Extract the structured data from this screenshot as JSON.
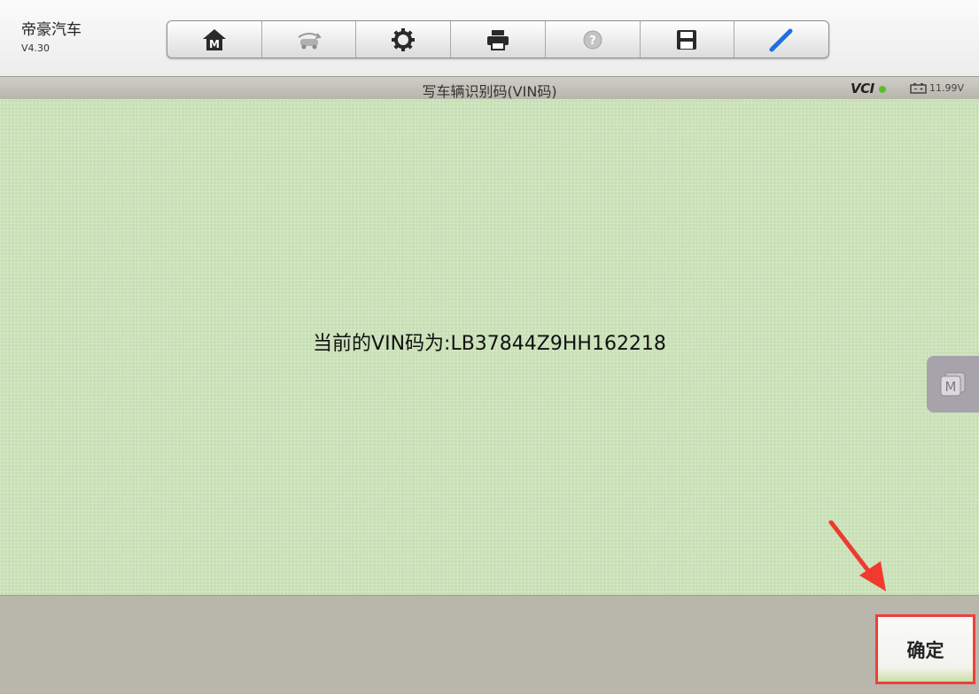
{
  "app": {
    "name": "帝豪汽车",
    "version": "V4.30"
  },
  "toolbar": {
    "tools": [
      "home-icon",
      "vehicle-swap-icon",
      "settings-icon",
      "print-icon",
      "help-icon",
      "save-icon",
      "edit-icon"
    ],
    "home_badge": "M"
  },
  "titlebar": {
    "title": "写车辆识别码(VIN码)",
    "vci_label": "VCI",
    "voltage": "11.99V"
  },
  "main": {
    "message": "当前的VIN码为:LB37844Z9HH162218",
    "float_button_label": "M"
  },
  "footer": {
    "confirm_label": "确定"
  },
  "colors": {
    "content_bg": "#c7dfb4",
    "bar_bg": "#b9b6ac",
    "highlight": "#ee3f3f",
    "vci_status": "#5bbf2a"
  }
}
